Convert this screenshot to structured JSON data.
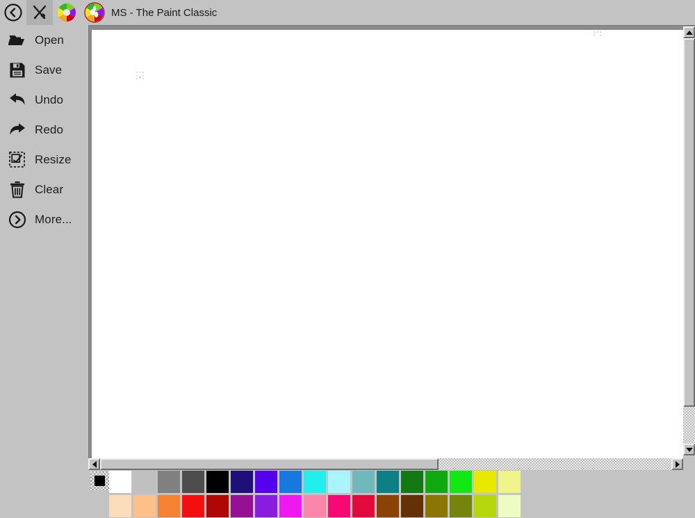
{
  "window": {
    "title": "MS - The Paint Classic",
    "back_icon": "back-circle-icon",
    "tools_icon": "brush-pencil-cross-icon",
    "color_wheel_icon": "color-wheel-icon",
    "app_icon": "paint-classic-app-icon"
  },
  "sidebar": {
    "items": [
      {
        "label": "Open",
        "icon": "folder-open-icon"
      },
      {
        "label": "Save",
        "icon": "floppy-disk-icon"
      },
      {
        "label": "Undo",
        "icon": "undo-arrow-icon"
      },
      {
        "label": "Redo",
        "icon": "redo-arrow-icon"
      },
      {
        "label": "Resize",
        "icon": "resize-dashed-box-icon"
      },
      {
        "label": "Clear",
        "icon": "trash-can-icon"
      },
      {
        "label": "More...",
        "icon": "chevron-right-circle-icon"
      }
    ]
  },
  "canvas": {
    "background_color": "#ffffff"
  },
  "scrollbars": {
    "vertical": {
      "up_icon": "triangle-up-icon",
      "down_icon": "triangle-down-icon"
    },
    "horizontal": {
      "left_icon": "triangle-left-icon",
      "right_icon": "triangle-right-icon"
    }
  },
  "palette": {
    "current_color": "#000000",
    "rows": [
      [
        "#ffffff",
        "#c0c0c0",
        "#808080",
        "#4d4d4d",
        "#000000",
        "#1f0f7a",
        "#5500ee",
        "#1878e0",
        "#22eeee",
        "#a8f4ff",
        "#6fb9bd",
        "#0d7f85",
        "#137a13",
        "#10a810",
        "#12e812",
        "#e8e800",
        "#eff48a"
      ],
      [
        "#fbdcb9",
        "#fbc188",
        "#f58232",
        "#f40f0f",
        "#b00606",
        "#961093",
        "#8a1ce0",
        "#ef18ef",
        "#fc85aa",
        "#f50a74",
        "#e00a3c",
        "#8a4205",
        "#643005",
        "#8a7505",
        "#75840a",
        "#b6d60d",
        "#eefcc4"
      ]
    ]
  }
}
